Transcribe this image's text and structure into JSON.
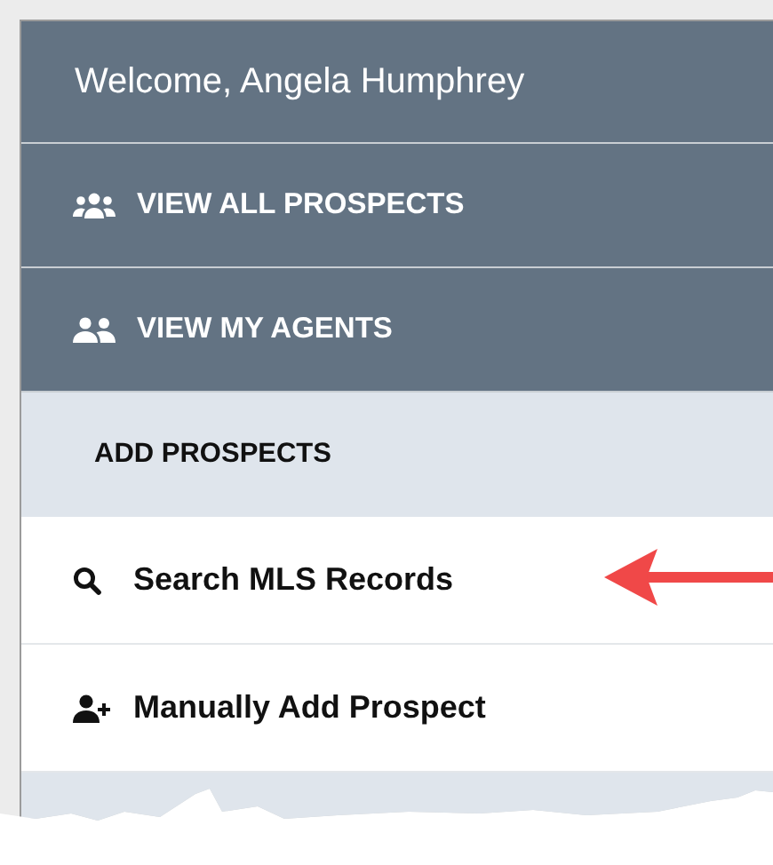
{
  "welcome": "Welcome, Angela Humphrey",
  "menu": [
    {
      "kind": "nav",
      "label": "VIEW ALL PROSPECTS"
    },
    {
      "kind": "nav",
      "label": "VIEW MY AGENTS"
    },
    {
      "kind": "header",
      "label": "ADD PROSPECTS"
    },
    {
      "kind": "link",
      "label": "Search MLS Records"
    },
    {
      "kind": "link",
      "label": "Manually Add Prospect"
    },
    {
      "kind": "header"
    }
  ]
}
